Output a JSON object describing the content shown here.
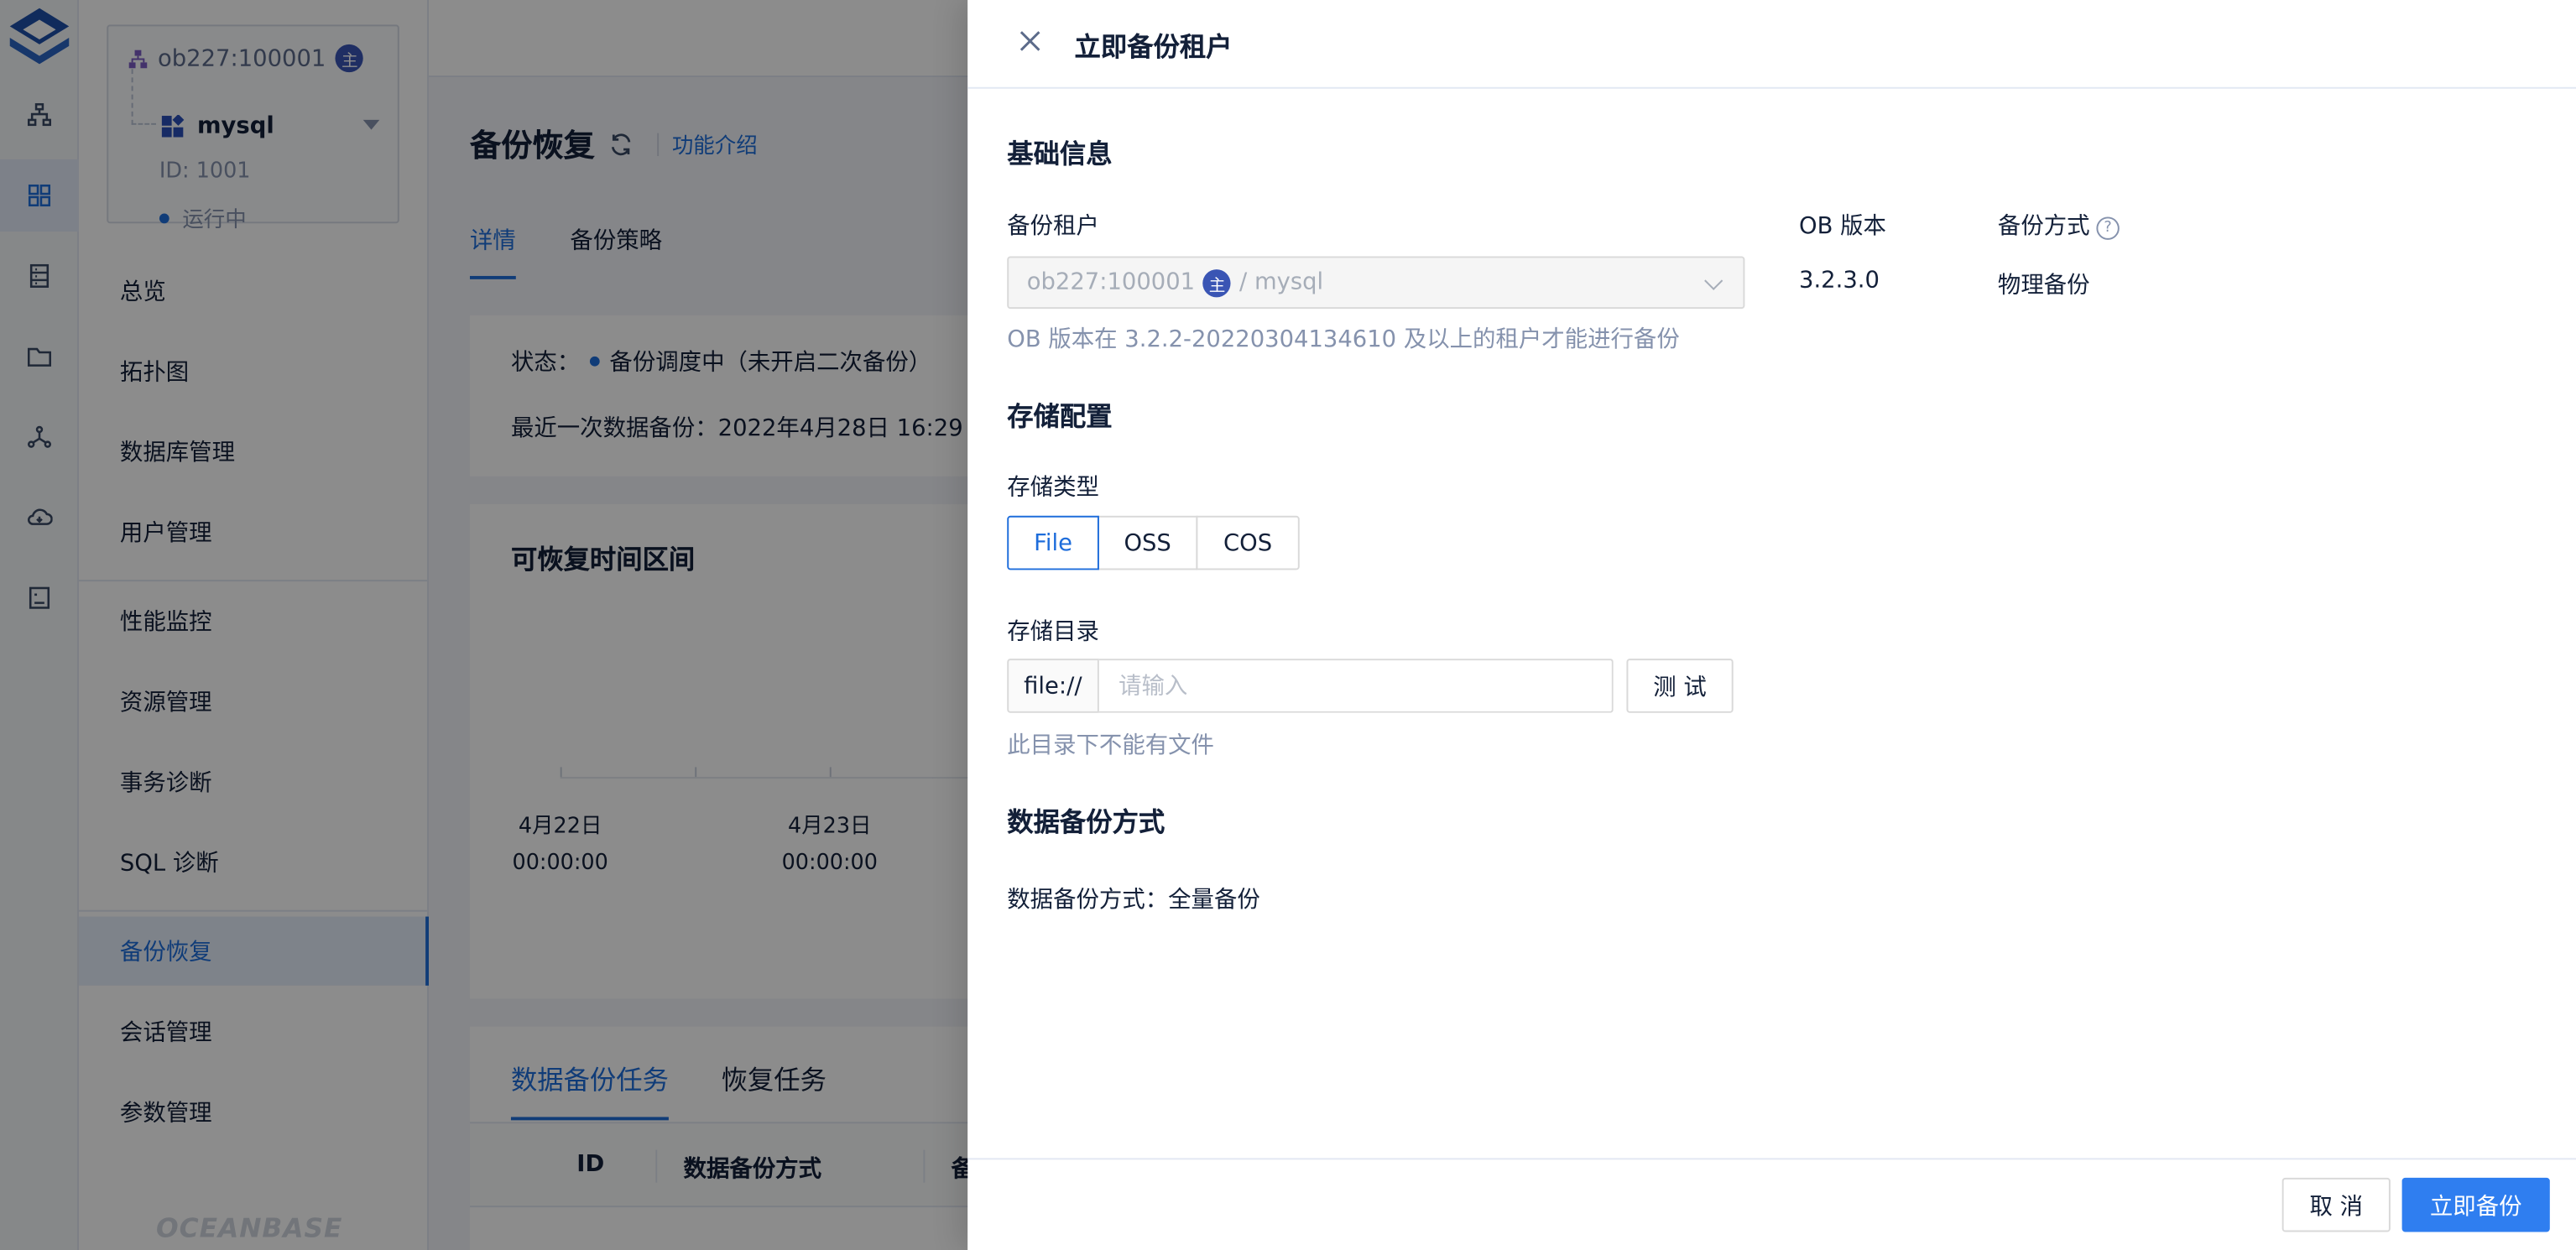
{
  "rail": {
    "icons": [
      "logo-icon",
      "topology-icon",
      "grid-icon",
      "database-icon",
      "folder-icon",
      "cluster-icon",
      "cloud-icon",
      "monitor-icon"
    ]
  },
  "tenant_card": {
    "cluster": "ob227:100001",
    "role_badge": "主",
    "tenant": "mysql",
    "id": "ID: 1001",
    "status": "运行中"
  },
  "nav": {
    "items": [
      "总览",
      "拓扑图",
      "数据库管理",
      "用户管理",
      "性能监控",
      "资源管理",
      "事务诊断",
      "SQL 诊断",
      "备份恢复",
      "会话管理",
      "参数管理"
    ],
    "active": "备份恢复",
    "watermark": "OCEANBASE"
  },
  "page": {
    "title": "备份恢复",
    "intro_link": "功能介绍",
    "tabs": [
      "详情",
      "备份策略"
    ],
    "status_label": "状态：",
    "status_value": "备份调度中（未开启二次备份）",
    "last_backup": "最近一次数据备份：2022年4月28日 16:29",
    "range_title": "可恢复时间区间",
    "timeline": [
      {
        "date": "4月22日",
        "time": "00:00:00"
      },
      {
        "date": "4月23日",
        "time": "00:00:00"
      }
    ],
    "task_tabs": [
      "数据备份任务",
      "恢复任务"
    ],
    "table_headers": [
      "ID",
      "数据备份方式",
      "备"
    ]
  },
  "drawer": {
    "title": "立即备份租户",
    "basic_section": "基础信息",
    "tenant_label": "备份租户",
    "tenant_cluster": "ob227:100001",
    "tenant_badge": "主",
    "tenant_suffix": "/ mysql",
    "ob_version_label": "OB 版本",
    "ob_version": "3.2.3.0",
    "backup_method_label": "备份方式",
    "backup_method": "物理备份",
    "version_hint": "OB 版本在 3.2.2-20220304134610 及以上的租户才能进行备份",
    "storage_section": "存储配置",
    "storage_type_label": "存储类型",
    "storage_types": [
      "File",
      "OSS",
      "COS"
    ],
    "storage_type_selected": "File",
    "storage_dir_label": "存储目录",
    "dir_prefix": "file://",
    "dir_placeholder": "请输入",
    "dir_value": "",
    "test_button": "测 试",
    "dir_hint": "此目录下不能有文件",
    "data_backup_section": "数据备份方式",
    "data_backup_line": "数据备份方式：全量备份",
    "cancel_button": "取 消",
    "submit_button": "立即备份"
  },
  "colors": {
    "primary": "#1e6ddb",
    "button_primary": "#2f7ef0",
    "badge": "#3a55b4",
    "text": "#132039",
    "muted": "#8592ad"
  }
}
